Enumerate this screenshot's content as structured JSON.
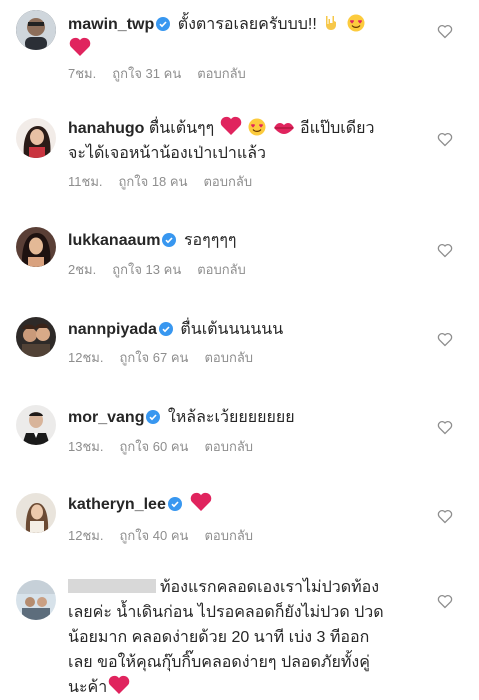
{
  "comments": [
    {
      "username": "mawin_twp",
      "verified": true,
      "text": "ตั้งตารอเลยครับบบ!!",
      "time": "7ชม.",
      "likes": "ถูกใจ 31 คน",
      "reply": "ตอบกลับ"
    },
    {
      "username": "hanahugo",
      "verified": false,
      "text": "ตื่นเต้นๆๆ",
      "text2": "อีแป๊บเดียว",
      "text3": "จะได้เจอหน้าน้องเป่าเปาแล้ว",
      "time": "11ชม.",
      "likes": "ถูกใจ 18 คน",
      "reply": "ตอบกลับ"
    },
    {
      "username": "lukkanaaum",
      "verified": true,
      "text": "รอๆๆๆๆ",
      "time": "2ชม.",
      "likes": "ถูกใจ 13 คน",
      "reply": "ตอบกลับ"
    },
    {
      "username": "nannpiyada",
      "verified": true,
      "text": "ตื่นเต้นนนนนน",
      "time": "12ชม.",
      "likes": "ถูกใจ 67 คน",
      "reply": "ตอบกลับ"
    },
    {
      "username": "mor_vang",
      "verified": true,
      "text": "ใหล้ละเว้ยยยยยยย",
      "time": "13ชม.",
      "likes": "ถูกใจ 60 คน",
      "reply": "ตอบกลับ"
    },
    {
      "username": "katheryn_lee",
      "verified": true,
      "text": "",
      "time": "12ชม.",
      "likes": "ถูกใจ 40 คน",
      "reply": "ตอบกลับ"
    },
    {
      "username": "",
      "verified": false,
      "line1": "ท้องแรกคลอดเองเราไม่ปวดท้อง",
      "line2": "เลยค่ะ น้ำเดินก่อน ไปรอคลอดก็ยังไม่ปวด ปวด",
      "line3": "น้อยมาก คลอดง่ายด้วย 20 นาที เบ่ง 3 ทีออก",
      "line4": "เลย ขอให้คุณกุ๊บกิ๊บคลอดง่ายๆ ปลอดภัยทั้งคู่",
      "line5": "นะค้า"
    }
  ],
  "icons": {
    "like": "heart-outline-icon",
    "verified": "verified-badge-icon"
  },
  "colors": {
    "verified": "#3897f0",
    "heart": "#ed4956",
    "meta": "#8e8e8e"
  }
}
